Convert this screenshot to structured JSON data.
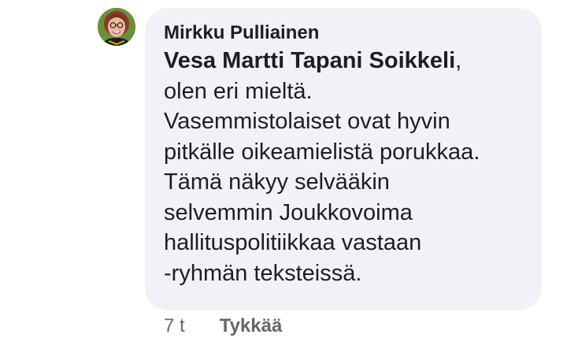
{
  "comment": {
    "author": "Mirkku Pulliainen",
    "mention": "Vesa Martti Tapani Soikkeli",
    "mention_suffix": ",",
    "lines": [
      "olen eri mieltä.",
      "Vasemmistolaiset ovat hyvin",
      "pitkälle oikeamielistä porukkaa.",
      "Tämä näkyy selvääkin",
      "selvemmin Joukkovoima",
      "hallituspolitiikkaa vastaan",
      "-ryhmän teksteissä."
    ],
    "time": "7 t",
    "like_label": "Tykkää"
  },
  "colors": {
    "bubble_bg": "#f0f2f5",
    "text": "#1c1e21",
    "meta_text": "#65676b"
  },
  "icons": {
    "avatar": "profile-photo"
  }
}
